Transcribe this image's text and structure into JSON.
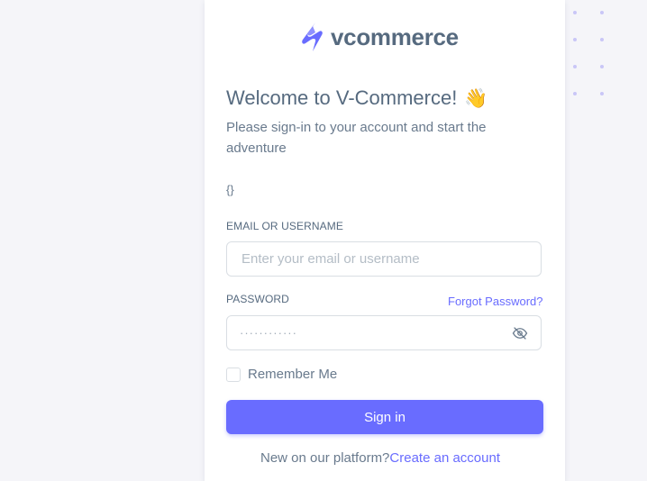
{
  "brand": {
    "name": "vcommerce"
  },
  "welcome": {
    "title": "Welcome to V-Commerce!",
    "emoji": "👋",
    "subtitle": "Please sign-in to your account and start the adventure",
    "debug_text": "{}"
  },
  "form": {
    "email_label": "EMAIL OR USERNAME",
    "email_placeholder": "Enter your email or username",
    "password_label": "PASSWORD",
    "forgot_password": "Forgot Password?",
    "password_mask": "············",
    "remember_me": "Remember Me",
    "submit": "Sign in"
  },
  "footer": {
    "prompt": "New on our platform?",
    "link": "Create an account"
  },
  "icons": {
    "brand": "brand-logo-icon",
    "password_visibility": "eye-off-icon",
    "greeting": "waving-hand-icon"
  },
  "colors": {
    "primary": "#696cff",
    "text": "#566a7f",
    "muted": "#697a8d",
    "border": "#d9dee3",
    "background": "#f5f5f9",
    "dots": "#c9c6f7"
  }
}
